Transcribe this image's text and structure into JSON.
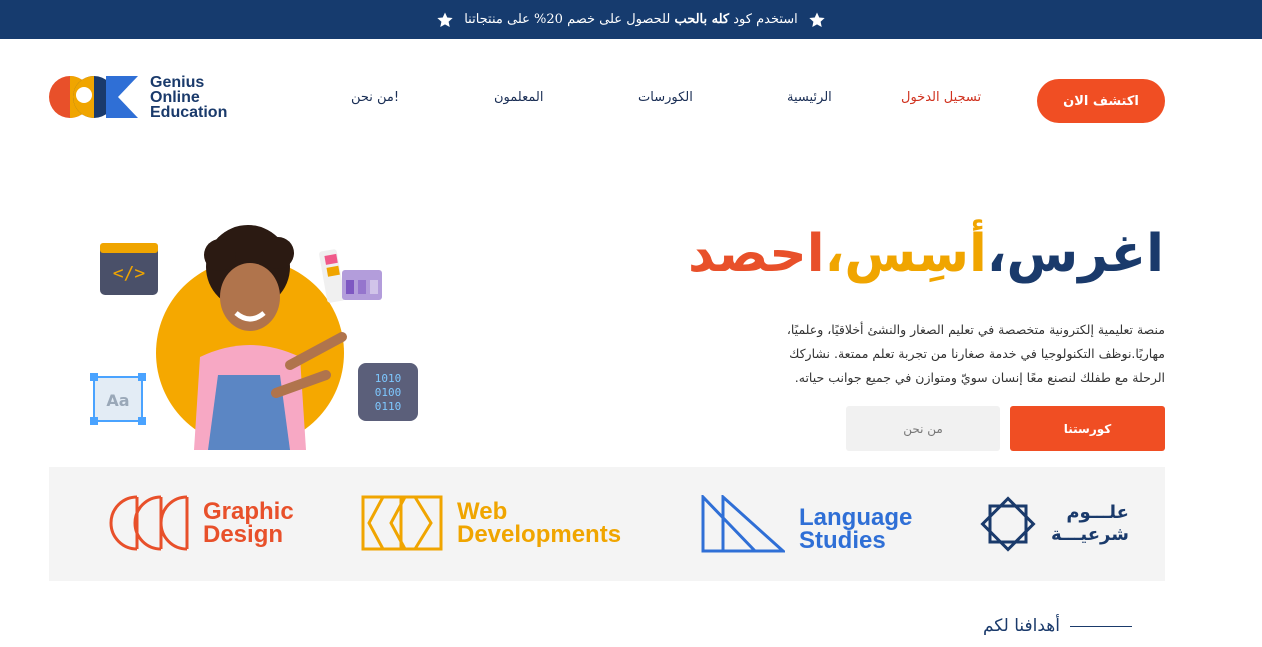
{
  "promo": {
    "prefix": "استخدم كود",
    "code": "كله بالحب",
    "suffix": "للحصول على خصم 20% على منتجاتنا",
    "icon": "star-icon"
  },
  "logo": {
    "line1": "Genius",
    "line2": "Online",
    "line3": "Education"
  },
  "nav": {
    "about": "من نحن!",
    "teachers": "المعلمون",
    "courses": "الكورسات",
    "home": "الرئيسية",
    "login": "تسجيل الدخول",
    "cta": "اكتشف الان"
  },
  "hero": {
    "word1": "اغرس،",
    "word2": "أسِس،",
    "word3": "احصد",
    "desc_line1": "منصة تعليمية إلكترونية متخصصة في تعليم الصغار والنشئ أخلاقيًا، وعلميًا،",
    "desc_line2": "مهاريًا.نوظف التكنولوجيا في خدمة صغارنا من تجربة تعلم ممتعة. نشاركك",
    "desc_line3": "الرحلة مع طفلك لنصنع معًا إنسان سويّ ومتوازن في جميع جوانب حياته.",
    "primary_button": "كورستنا",
    "secondary_button": "من نحن"
  },
  "categories": {
    "graphic": {
      "line1": "Graphic",
      "line2": "Design",
      "color": "#e8502a"
    },
    "web": {
      "line1": "Web",
      "line2": "Developments",
      "color": "#f0a500"
    },
    "language": {
      "line1": "Language",
      "line2": "Studies",
      "color": "#2f6fd6"
    },
    "sharia": {
      "line1": "علـــوم",
      "line2": "شرعيـــة",
      "color": "#1a3a6b"
    }
  },
  "goals": {
    "title": "أهدافنا لكم"
  },
  "colors": {
    "navy": "#163b6e",
    "orange": "#f04e23",
    "yellow": "#f0a500",
    "blue": "#2f6fd6"
  }
}
